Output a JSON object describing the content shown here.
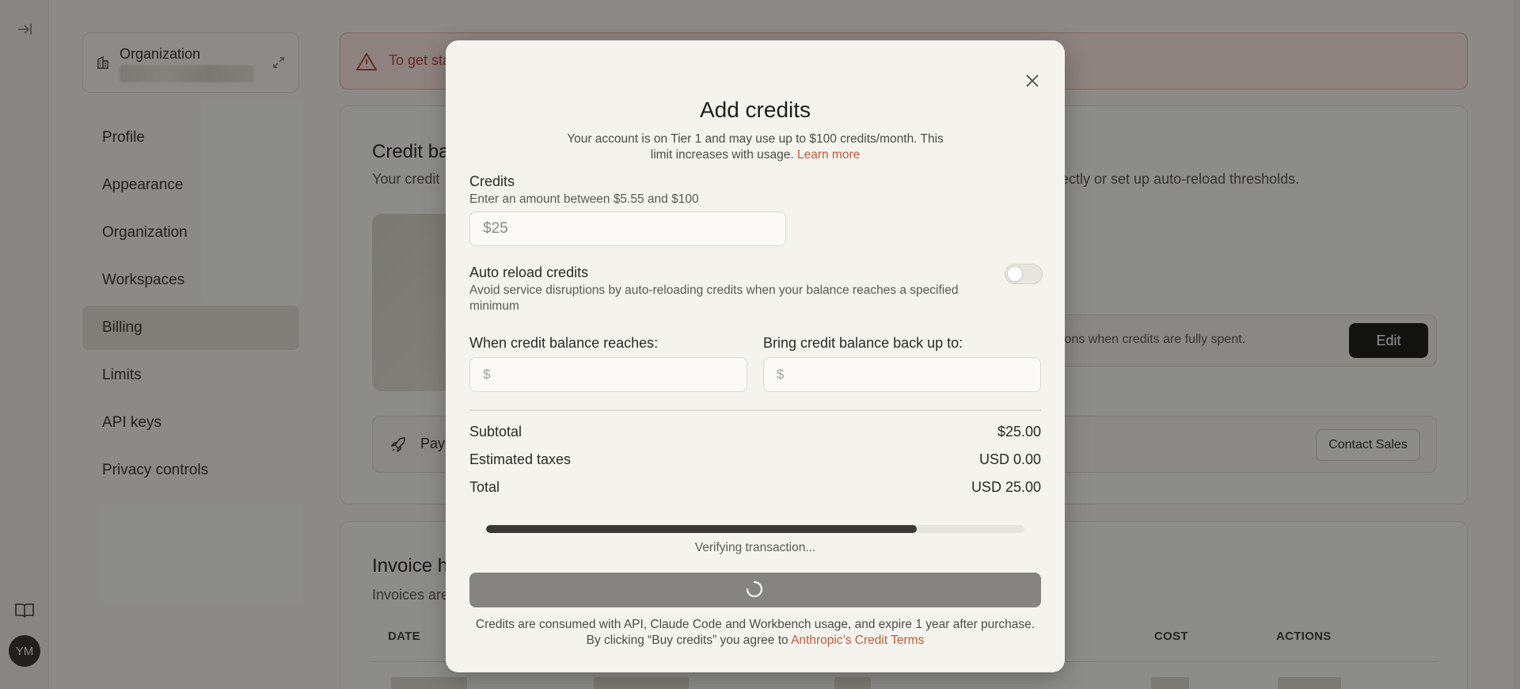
{
  "sidebar": {
    "org_name": "Organization",
    "items": [
      {
        "label": "Profile"
      },
      {
        "label": "Appearance"
      },
      {
        "label": "Organization"
      },
      {
        "label": "Workspaces"
      },
      {
        "label": "Billing"
      },
      {
        "label": "Limits"
      },
      {
        "label": "API keys"
      },
      {
        "label": "Privacy controls"
      }
    ],
    "avatar_initials": "YM"
  },
  "banner": {
    "text": "To get sta"
  },
  "credit_panel": {
    "title": "Credit ba",
    "subtitle_left": "Your credit",
    "subtitle_right": "ectly or set up auto-reload thresholds.",
    "autoreload_text": "ions when credits are fully spent.",
    "edit_label": "Edit",
    "pay_text": "Pay",
    "contact_label": "Contact Sales"
  },
  "invoice_panel": {
    "title": "Invoice h",
    "subtitle": "Invoices are",
    "headers": [
      "DATE",
      "COST",
      "ACTIONS"
    ]
  },
  "modal": {
    "title": "Add credits",
    "description": "Your account is on Tier 1 and may use up to $100 credits/month. This limit increases with usage.",
    "learn_more": "Learn more",
    "credits_label": "Credits",
    "credits_hint": "Enter an amount between $5.55 and $100",
    "credits_value": "$25",
    "auto_reload_label": "Auto reload credits",
    "auto_reload_hint": "Avoid service disruptions by auto-reloading credits when your balance reaches a specified minimum",
    "auto_reload_enabled": false,
    "threshold_label": "When credit balance reaches:",
    "threshold_prefix": "$",
    "topup_label": "Bring credit balance back up to:",
    "topup_prefix": "$",
    "summary": {
      "subtotal_label": "Subtotal",
      "subtotal_value": "$25.00",
      "taxes_label": "Estimated taxes",
      "taxes_value": "USD 0.00",
      "total_label": "Total",
      "total_value": "USD 25.00"
    },
    "progress_fraction": 0.8,
    "status_text": "Verifying transaction...",
    "footer_line1": "Credits are consumed with API, Claude Code and Workbench usage, and expire 1 year after purchase.",
    "footer_line2_prefix": "By clicking “Buy credits” you agree to",
    "footer_link": "Anthropic’s Credit Terms"
  },
  "colors": {
    "accent_link": "#c25a3c",
    "banner_text": "#b2433a",
    "progress_fill": "#3a3935"
  }
}
